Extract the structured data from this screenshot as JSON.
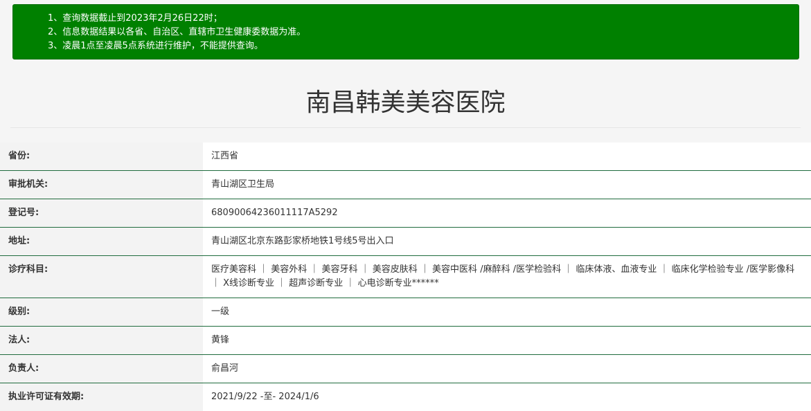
{
  "notice": {
    "lines": [
      "1、查询数据截止到2023年2月26日22时；",
      "2、信息数据结果以各省、自治区、直辖市卫生健康委数据为准。",
      "3、凌晨1点至凌晨5点系统进行维护，不能提供查询。"
    ]
  },
  "title": "南昌韩美美容医院",
  "rows": [
    {
      "label": "省份:",
      "value": "江西省"
    },
    {
      "label": "审批机关:",
      "value": "青山湖区卫生局"
    },
    {
      "label": "登记号:",
      "value": "68090064236011117A5292"
    },
    {
      "label": "地址:",
      "value": "青山湖区北京东路彭家桥地铁1号线5号出入口"
    },
    {
      "label": "诊疗科目:",
      "value": "医疗美容科 ｜ 美容外科 ｜ 美容牙科 ｜ 美容皮肤科 ｜ 美容中医科 /麻醉科 /医学检验科 ｜ 临床体液、血液专业 ｜ 临床化学检验专业 /医学影像科 ｜ X线诊断专业 ｜ 超声诊断专业 ｜ 心电诊断专业******"
    },
    {
      "label": "级别:",
      "value": "一级"
    },
    {
      "label": "法人:",
      "value": "黄锋"
    },
    {
      "label": "负责人:",
      "value": "俞昌河"
    },
    {
      "label": "执业许可证有效期:",
      "value": "2021/9/22 -至- 2024/1/6"
    }
  ]
}
